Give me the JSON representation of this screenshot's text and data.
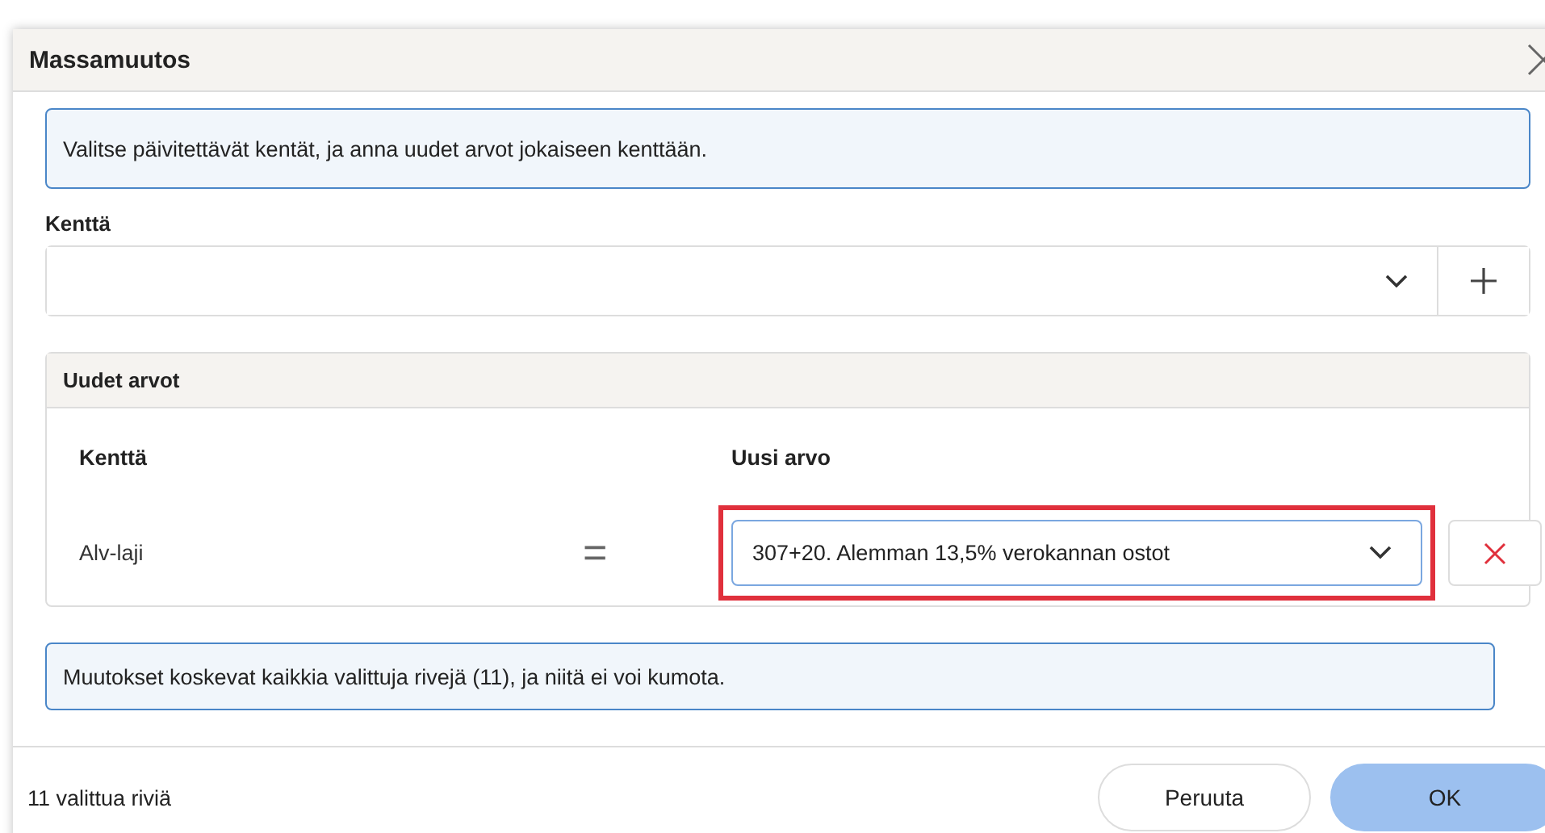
{
  "dialog": {
    "title": "Massamuutos"
  },
  "intro": "Valitse päivitettävät kentät, ja anna uudet arvot jokaiseen kenttään.",
  "field_picker": {
    "label": "Kenttä"
  },
  "new_values": {
    "title": "Uudet arvot",
    "columns": [
      "Kenttä",
      "Uusi arvo"
    ],
    "rows": [
      {
        "field": "Alv-laji",
        "operator": "=",
        "value": "307+20. Alemman 13,5% verokannan ostot",
        "highlighted": true
      }
    ]
  },
  "warning": "Muutokset koskevat kaikkia valittuja rivejä (11), ja niitä ei voi kumota.",
  "footer": {
    "count": "11 valittua riviä",
    "buttons": [
      {
        "label": "Peruuta",
        "kind": "secondary"
      },
      {
        "label": "OK",
        "kind": "primary"
      }
    ]
  }
}
